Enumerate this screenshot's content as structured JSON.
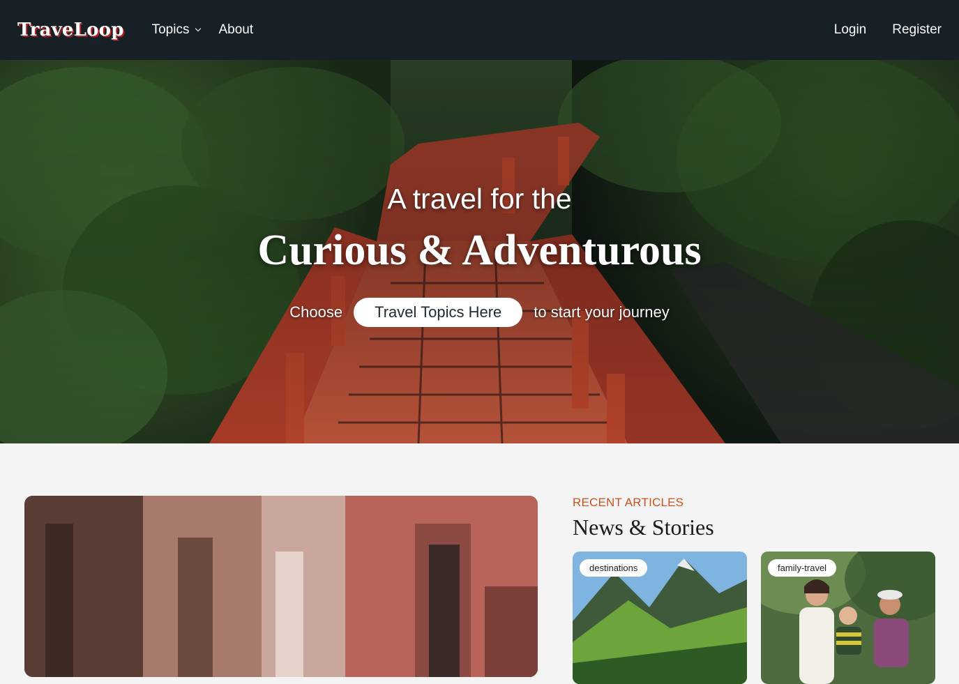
{
  "navbar": {
    "logo": "TraveLoop",
    "links": {
      "topics": "Topics",
      "about": "About"
    },
    "auth": {
      "login": "Login",
      "register": "Register"
    }
  },
  "hero": {
    "line1": "A travel for the",
    "line2": "Curious & Adventurous",
    "cta_before": "Choose",
    "cta_button": "Travel Topics Here",
    "cta_after": "to start your journey"
  },
  "recent": {
    "tag": "RECENT ARTICLES",
    "title": "News & Stories",
    "cards": [
      {
        "badge": "destinations"
      },
      {
        "badge": "family-travel"
      }
    ]
  },
  "colors": {
    "navbar_bg": "#171f27",
    "accent": "#c8531e",
    "logo_shadow": "#b3201e"
  }
}
